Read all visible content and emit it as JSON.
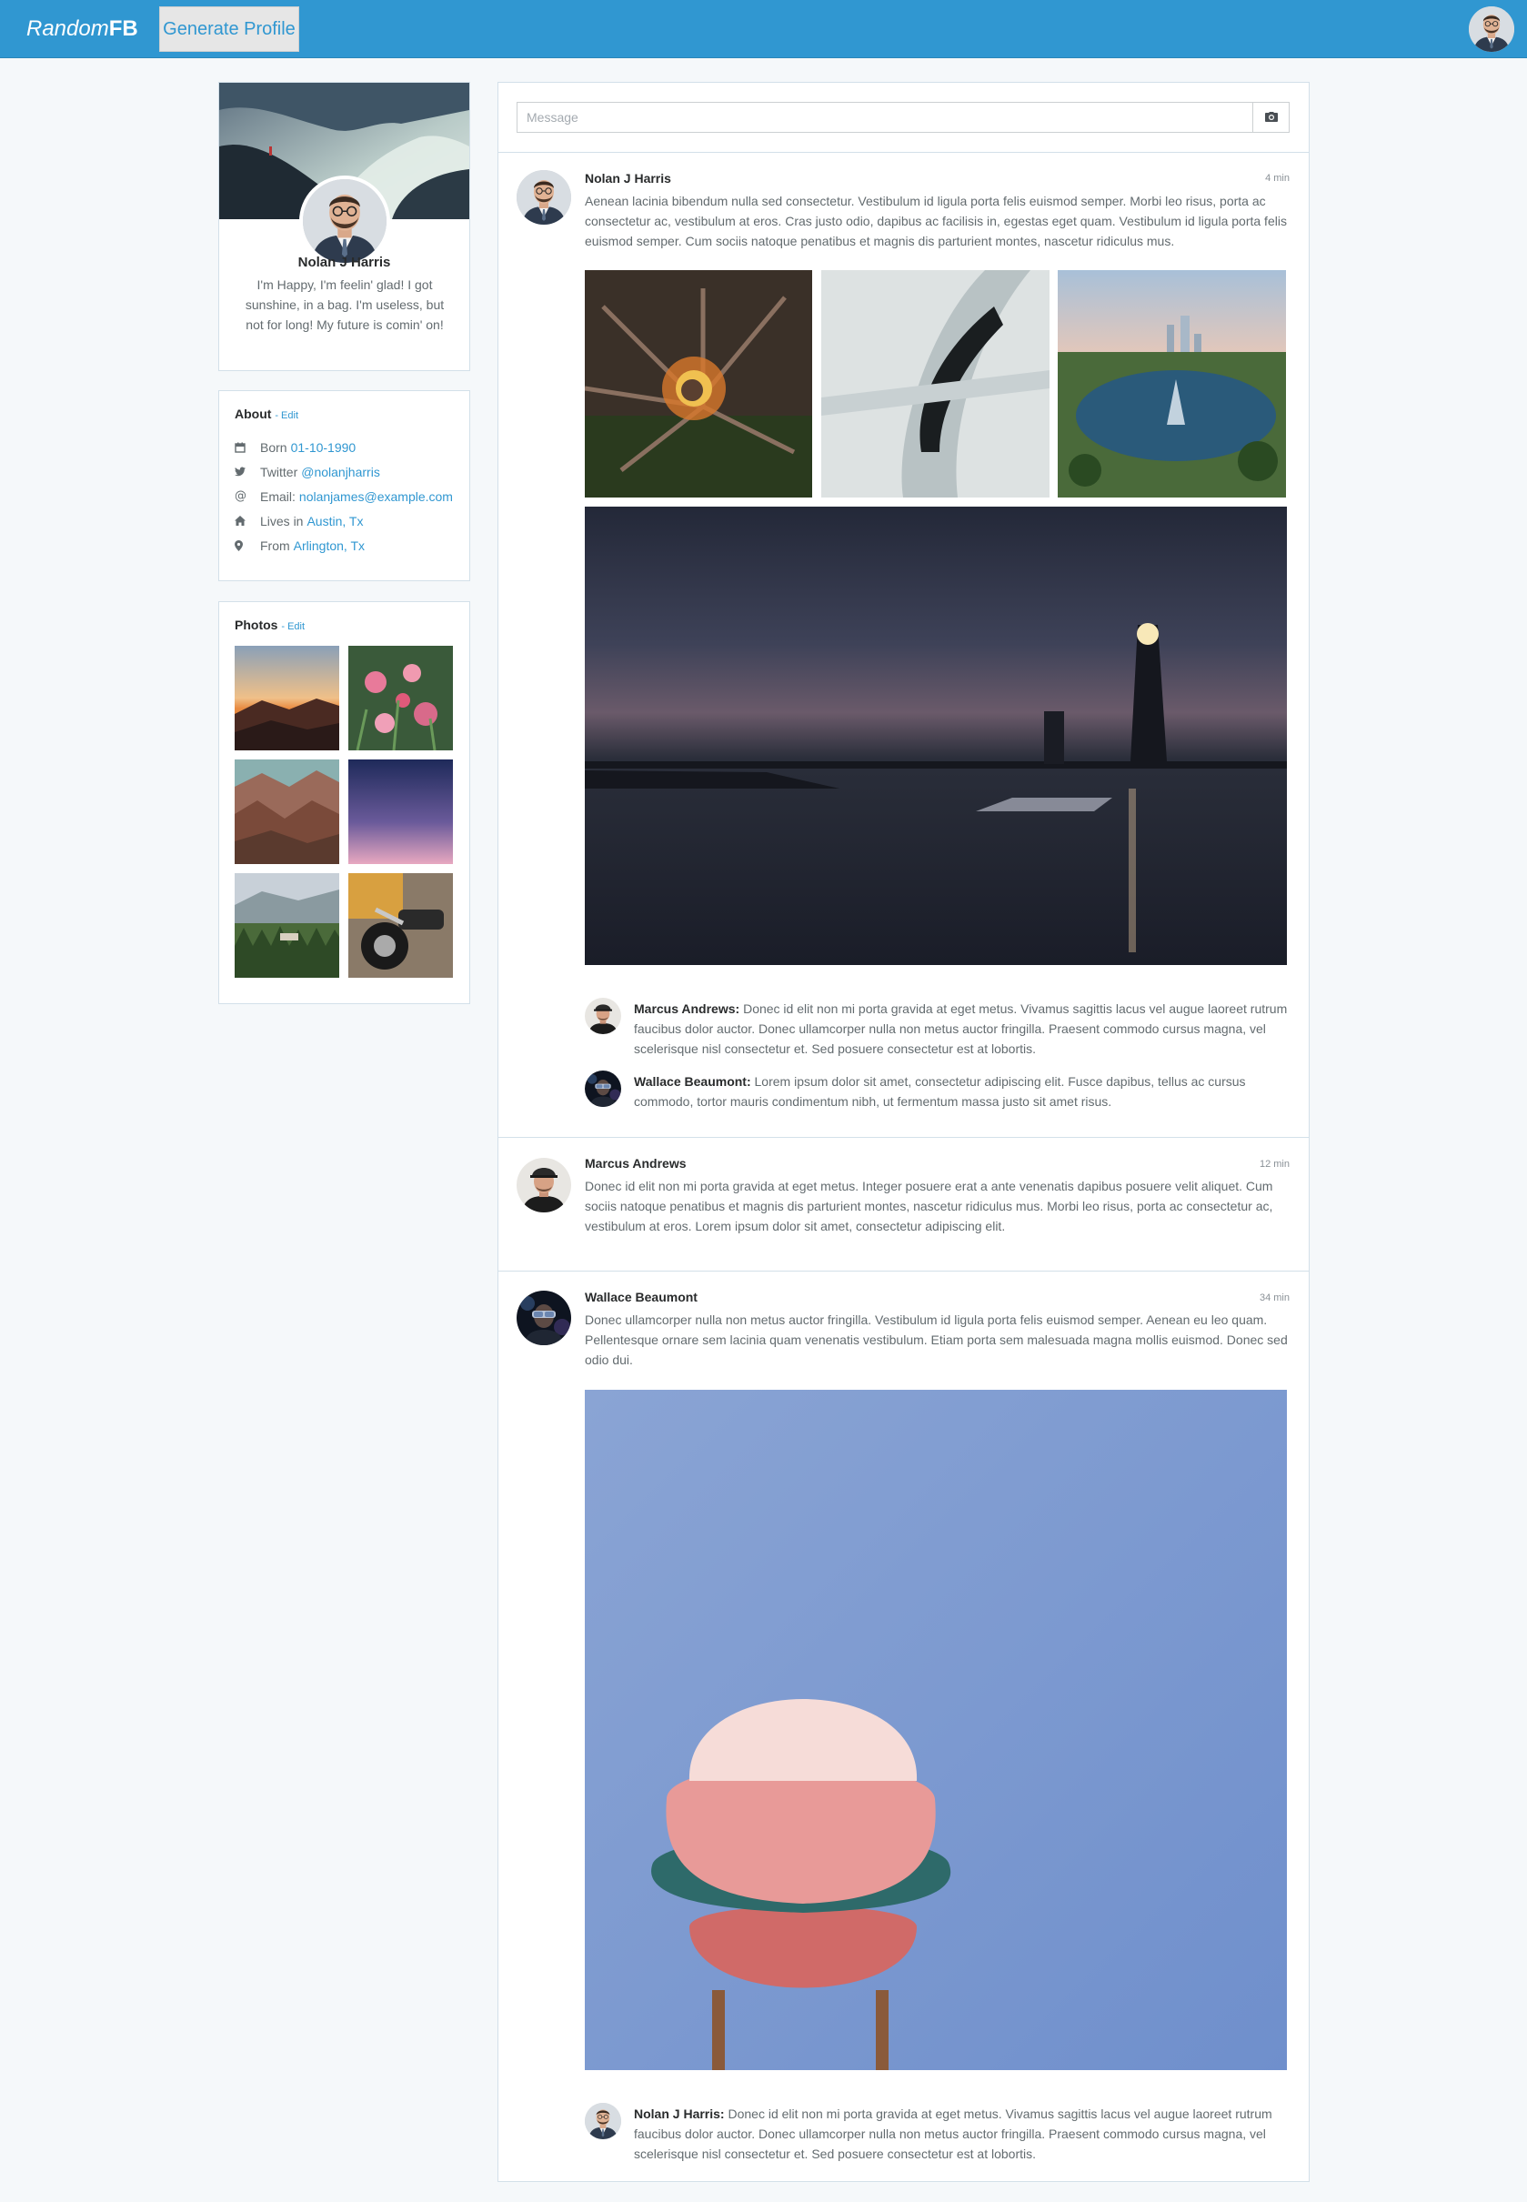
{
  "navbar": {
    "brand_italic": "Random",
    "brand_bold": "FB",
    "generate_label": "Generate Profile"
  },
  "profile": {
    "name": "Nolan J Harris",
    "bio": "I'm Happy, I'm feelin' glad! I got sunshine, in a bag. I'm useless, but not for long! My future is comin' on!"
  },
  "about": {
    "title": "About",
    "edit": "- Edit",
    "items": [
      {
        "icon": "calendar-icon",
        "label": "Born",
        "value": "01-10-1990"
      },
      {
        "icon": "twitter-icon",
        "label": "Twitter",
        "value": "@nolanjharris"
      },
      {
        "icon": "at-icon",
        "label": "Email:",
        "value": "nolanjames@example.com"
      },
      {
        "icon": "home-icon",
        "label": "Lives in",
        "value": "Austin, Tx"
      },
      {
        "icon": "map-marker-icon",
        "label": "From",
        "value": "Arlington, Tx"
      }
    ]
  },
  "photos": {
    "title": "Photos",
    "edit": "- Edit",
    "items": [
      "sunset-rocks",
      "pink-flowers",
      "canyon",
      "purple-sky",
      "forest-valley",
      "motorcycle"
    ]
  },
  "composer": {
    "placeholder": "Message",
    "icon": "camera-icon"
  },
  "posts": [
    {
      "author": "Nolan J Harris",
      "time": "4 min",
      "text": "Aenean lacinia bibendum nulla sed consectetur. Vestibulum id ligula porta felis euismod semper. Morbi leo risus, porta ac consectetur ac, vestibulum at eros. Cras justo odio, dapibus ac facilisis in, egestas eget quam. Vestibulum id ligula porta felis euismod semper. Cum sociis natoque penatibus et magnis dis parturient montes, nascetur ridiculus mus.",
      "images": [
        "campfire",
        "white-sculpture",
        "city-lake",
        "lighthouse"
      ],
      "comments": [
        {
          "author": "Marcus Andrews:",
          "text": "Donec id elit non mi porta gravida at eget metus. Vivamus sagittis lacus vel augue laoreet rutrum faucibus dolor auctor. Donec ullamcorper nulla non metus auctor fringilla. Praesent commodo cursus magna, vel scelerisque nisl consectetur et. Sed posuere consectetur est at lobortis."
        },
        {
          "author": "Wallace Beaumont:",
          "text": "Lorem ipsum dolor sit amet, consectetur adipiscing elit. Fusce dapibus, tellus ac cursus commodo, tortor mauris condimentum nibh, ut fermentum massa justo sit amet risus."
        }
      ]
    },
    {
      "author": "Marcus Andrews",
      "time": "12 min",
      "text": "Donec id elit non mi porta gravida at eget metus. Integer posuere erat a ante venenatis dapibus posuere velit aliquet. Cum sociis natoque penatibus et magnis dis parturient montes, nascetur ridiculus mus. Morbi leo risus, porta ac consectetur ac, vestibulum at eros. Lorem ipsum dolor sit amet, consectetur adipiscing elit."
    },
    {
      "author": "Wallace Beaumont",
      "time": "34 min",
      "text": "Donec ullamcorper nulla non metus auctor fringilla. Vestibulum id ligula porta felis euismod semper. Aenean eu leo quam. Pellentesque ornare sem lacinia quam venenatis vestibulum. Etiam porta sem malesuada magna mollis euismod. Donec sed odio dui.",
      "images": [
        "burger-sign"
      ],
      "comments": [
        {
          "author": "Nolan J Harris:",
          "text": "Donec id elit non mi porta gravida at eget metus. Vivamus sagittis lacus vel augue laoreet rutrum faucibus dolor auctor. Donec ullamcorper nulla non metus auctor fringilla. Praesent commodo cursus magna, vel scelerisque nisl consectetur et. Sed posuere consectetur est at lobortis."
        }
      ]
    }
  ],
  "colors": {
    "primary": "#3097d1",
    "background": "#f5f8fa",
    "border": "#d3e0e9"
  }
}
